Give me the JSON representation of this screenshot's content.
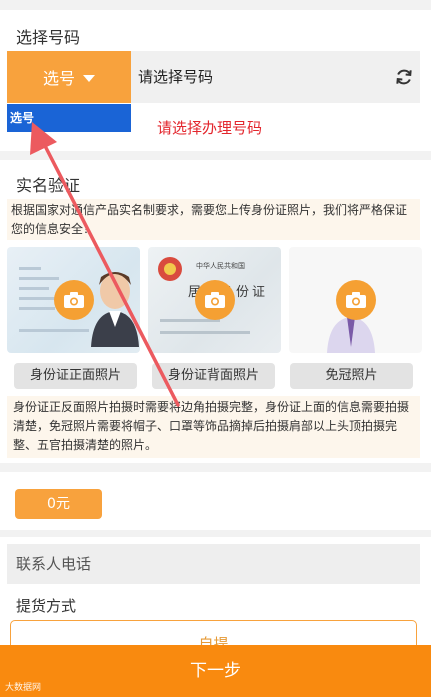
{
  "select_number": {
    "title": "选择号码",
    "select_button": "选号",
    "placeholder": "请选择号码",
    "dropdown_option": "选号",
    "hint": "请选择办理号码"
  },
  "verification": {
    "title": "实名验证",
    "notice": "根据国家对通信产品实名制要求，需要您上传身份证照片，我们将严格保证您的信息安全！",
    "buttons": [
      "身份证正面照片",
      "身份证背面照片",
      "免冠照片"
    ],
    "id_back_header": "中华人民共和国",
    "id_back_title": "居民身份证",
    "description": "身份证正反面照片拍摄时需要将边角拍摄完整，身份证上面的信息需要拍摄清楚，免冠照片需要将帽子、口罩等饰品摘掉后拍摄肩部以上头顶拍摄完整、五官拍摄清楚的照片。"
  },
  "price": "0元",
  "contact_phone_label": "联系人电话",
  "pickup": {
    "title": "提货方式",
    "option": "自提"
  },
  "next_button": "下一步",
  "watermark": "大数据网",
  "colors": {
    "accent": "#f8a23d",
    "next_bar": "#f98a0f",
    "dropdown_highlight": "#1a64d6",
    "hint_red": "#e3262d",
    "annotation_arrow": "#ec5a5f"
  }
}
